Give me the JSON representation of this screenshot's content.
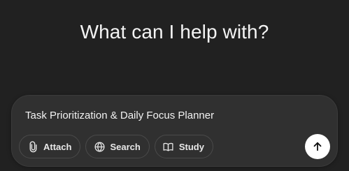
{
  "main": {
    "heading": "What can I help with?"
  },
  "composer": {
    "input_value": "Task Prioritization & Daily Focus Planner",
    "buttons": {
      "attach": {
        "label": "Attach",
        "icon": "paperclip-icon"
      },
      "search": {
        "label": "Search",
        "icon": "globe-icon"
      },
      "study": {
        "label": "Study",
        "icon": "book-icon"
      }
    },
    "send": {
      "icon": "arrow-up-icon"
    }
  },
  "colors": {
    "background": "#212121",
    "composer_bg": "#303030",
    "pill_border": "#4a4a4a",
    "send_bg": "#ffffff",
    "text": "#ececec"
  }
}
